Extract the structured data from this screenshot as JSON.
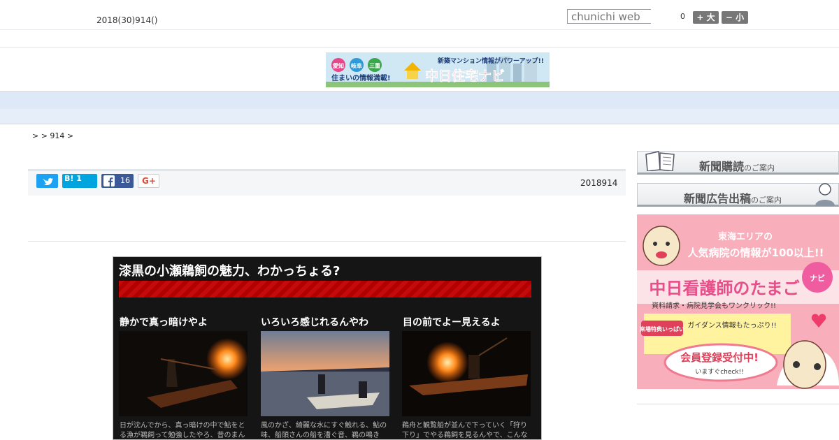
{
  "header": {
    "date": "2018(30)914()",
    "search_placeholder": "chunichi web",
    "font_count": "0",
    "font_big_label": "+ 大",
    "font_small_label": "− 小"
  },
  "banner": {
    "regions": [
      "愛知",
      "岐阜",
      "三重"
    ],
    "tagline": "住まいの情報満載!",
    "headline": "新築マンション情報がパワーアップ!!",
    "brand": "中日住宅ナビ"
  },
  "nav": {
    "items": [
      "",
      "",
      "",
      "",
      "",
      "",
      "",
      "",
      ""
    ]
  },
  "breadcrumb": ">  > 914 >",
  "share": {
    "twitter_count": "",
    "hatena_label": "B! 1",
    "facebook_count": "16",
    "gplus_label": "G+",
    "published": "2018914"
  },
  "article_image": {
    "title": "漆黒の小瀬鵜飼の魅力、わかっちょる?",
    "columns": [
      {
        "title": "静かで真っ暗けやよ",
        "text": "日が沈んでから、真っ暗けの中で鮎をとる漁が鵜飼って勉強したやろ、昔のまん"
      },
      {
        "title": "いろいろ感じれるんやわ",
        "text": "風のかざ、綺麗な水にすぐ触れる、鮎の味、船頭さんの船を漕ぐ音、鵜の鳴き"
      },
      {
        "title": "目の前でよー見えるよ",
        "text": "鵜舟と観覧船が並んで下っていく「狩り下り」でやる鵜飼を見るんやで、こんな近く"
      }
    ]
  },
  "sidebar": {
    "subscribe_main": "新聞購読",
    "subscribe_sub": "のご案内",
    "advert_main": "新聞広告出稿",
    "advert_sub": "のご案内",
    "nurse_ad": {
      "line1": "東海エリアの",
      "line2": "人気病院の情報が100以上!!",
      "brand": "中日看護師のたまご",
      "badge": "ナビ",
      "line3": "資料請求・病院見学会もワンクリック!!",
      "special": "来場特典いっぱい",
      "line4": "ガイダンス情報もたっぷり!!",
      "cta": "会員登録受付中!",
      "cta_sub": "いますぐcheck!!"
    }
  },
  "colors": {
    "nav_bg": "#dde9f7",
    "twitter": "#1da1f2",
    "hatena": "#00a4de",
    "facebook": "#3b5998",
    "art_red": "#c40a0a",
    "nurse_pink": "#f7a9b7"
  }
}
